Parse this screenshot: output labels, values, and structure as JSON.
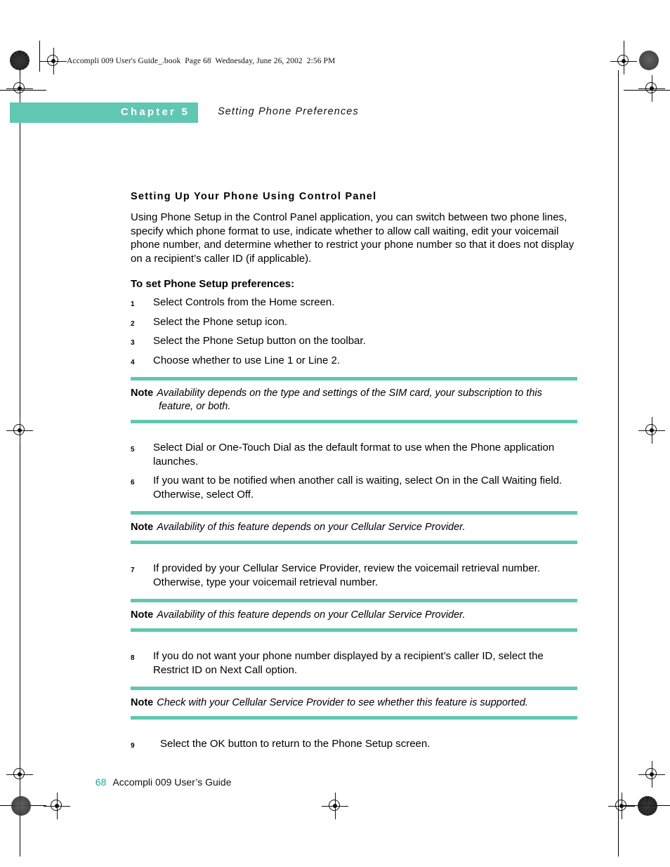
{
  "colors": {
    "teal": "#5fc7b2",
    "teal_text": "#17a894",
    "text": "#000000"
  },
  "running_head": "Accompli 009 User's Guide_.book  Page 68  Wednesday, June 26, 2002  2:56 PM",
  "chapter": {
    "label": "Chapter 5",
    "title": "Setting Phone Preferences"
  },
  "main": {
    "section_heading": "Setting Up Your Phone Using Control Panel",
    "intro": "Using Phone Setup in the Control Panel application, you can switch between two phone lines, specify which phone format to use, indicate whether to allow call waiting, edit your voicemail phone number, and determine whether to restrict your phone number so that it does not display on a recipient’s caller ID (if applicable).",
    "subhead": "To set Phone Setup preferences:",
    "steps": [
      {
        "num": "1",
        "text": "Select Controls from the Home screen."
      },
      {
        "num": "2",
        "text": "Select the Phone setup icon."
      },
      {
        "num": "3",
        "text": "Select the Phone Setup button on the toolbar."
      },
      {
        "num": "4",
        "text": "Choose whether to use Line 1 or Line 2."
      },
      {
        "num": "5",
        "text": "Select Dial or One-Touch Dial as the default format to use when the Phone application launches."
      },
      {
        "num": "6",
        "text": "If you want to be notified when another call is waiting, select On in the Call Waiting field. Otherwise, select Off."
      },
      {
        "num": "7",
        "text": " If provided by your Cellular Service Provider, review the voicemail retrieval number. Otherwise, type your voicemail retrieval number."
      },
      {
        "num": "8",
        "text": "If you do not want your phone number displayed by a recipient’s caller ID, select the Restrict ID on Next Call option."
      },
      {
        "num": "9",
        "text": "Select the OK button to return to the Phone Setup screen."
      }
    ],
    "notes": [
      {
        "label": "Note",
        "text": "Availability depends on the type and settings of the SIM card, your subscription to this feature, or both."
      },
      {
        "label": "Note",
        "text": "Availability of this feature depends on your Cellular Service Provider."
      },
      {
        "label": "Note",
        "text": "Availability of this feature depends on your Cellular Service Provider."
      },
      {
        "label": "Note",
        "text": "Check with your Cellular Service Provider to see whether this feature is supported."
      }
    ]
  },
  "footer": {
    "page_number": "68",
    "book_title": "Accompli 009 User’s Guide"
  }
}
